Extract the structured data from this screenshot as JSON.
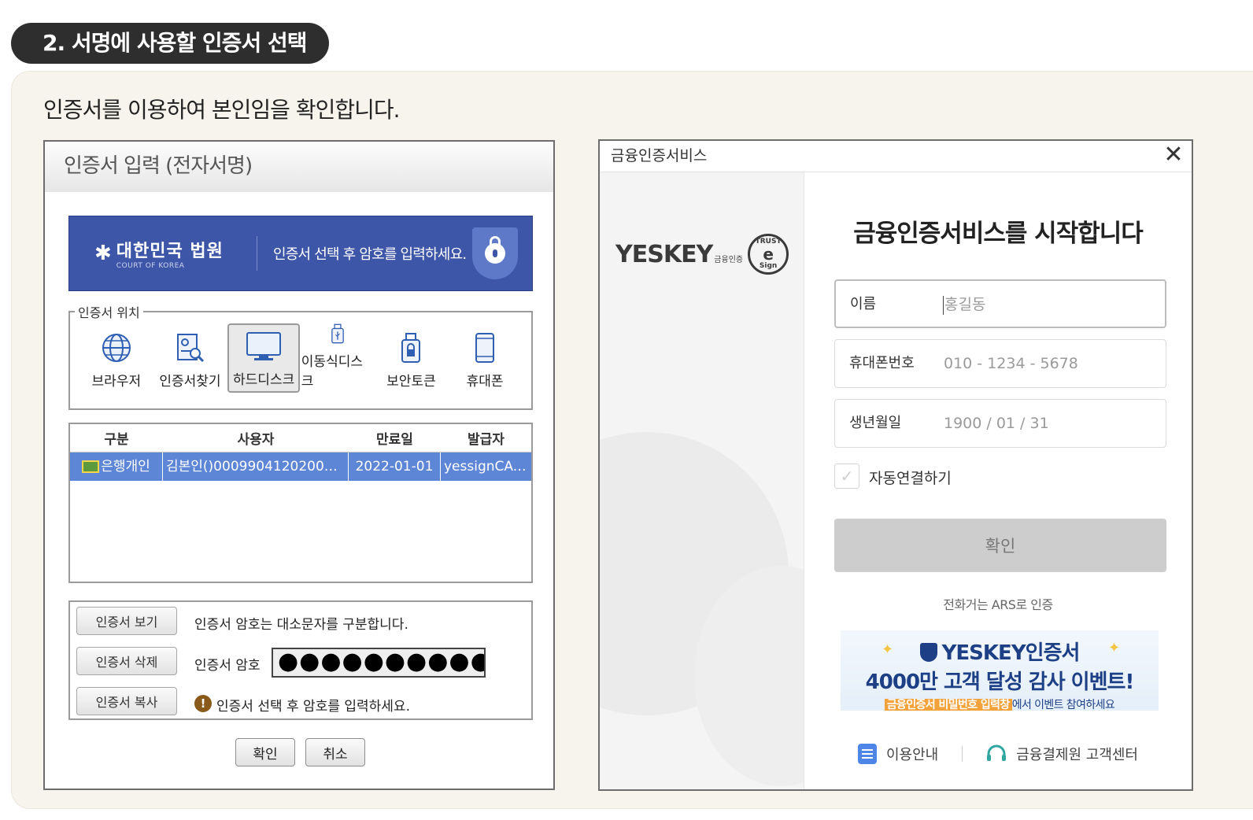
{
  "step": {
    "title": "2. 서명에 사용할 인증서 선택"
  },
  "intro": "인증서를 이용하여 본인임을 확인합니다.",
  "court_dialog": {
    "title": "인증서 입력 (전자서명)",
    "banner": {
      "org_name_ko": "대한민국 법원",
      "org_name_en": "COURT OF KOREA",
      "message": "인증서 선택 후 암호를 입력하세요."
    },
    "location_legend": "인증서 위치",
    "locations": [
      {
        "label": "브라우저",
        "icon": "globe-icon"
      },
      {
        "label": "인증서찾기",
        "icon": "cert-search-icon"
      },
      {
        "label": "하드디스크",
        "icon": "monitor-icon",
        "selected": true
      },
      {
        "label": "이동식디스크",
        "icon": "usb-icon"
      },
      {
        "label": "보안토큰",
        "icon": "security-token-icon"
      },
      {
        "label": "휴대폰",
        "icon": "phone-icon"
      }
    ],
    "table": {
      "headers": [
        "구분",
        "사용자",
        "만료일",
        "발급자"
      ],
      "rows": [
        {
          "type": "은행개인",
          "user": "김본인()0009904120200708...",
          "expiry": "2022-01-01",
          "issuer": "yessignCA-..."
        }
      ]
    },
    "buttons": {
      "view": "인증서 보기",
      "delete": "인증서 삭제",
      "copy": "인증서 복사",
      "ok": "확인",
      "cancel": "취소"
    },
    "case_notice": "인증서 암호는 대소문자를 구분합니다.",
    "password_label": "인증서 암호",
    "password_value": "●●●●●●●●●●",
    "warning": "인증서 선택 후 암호를 입력하세요."
  },
  "fin_dialog": {
    "window_title": "금융인증서비스",
    "close_label": "✕",
    "logo_word": "YESKEY",
    "logo_sub": "금융인증",
    "logo_mark_top": "TRUST",
    "logo_mark_bottom": "Sign",
    "heading": "금융인증서비스를 시작합니다",
    "fields": {
      "name": {
        "label": "이름",
        "placeholder": "홍길동"
      },
      "phone": {
        "label": "휴대폰번호",
        "placeholder": "010 - 1234 - 5678"
      },
      "birth": {
        "label": "생년월일",
        "placeholder": "1900 / 01 / 31"
      }
    },
    "auto_connect": "자동연결하기",
    "confirm": "확인",
    "ars": "전화거는 ARS로 인증",
    "event": {
      "line1": "YESKEY인증서",
      "line2": "4000만 고객 달성 감사 이벤트!",
      "line3_highlight": "금융인증서 비밀번호 입력창",
      "line3_rest": "에서 이벤트 참여하세요"
    },
    "footer": {
      "guide": "이용안내",
      "support": "금융결제원 고객센터"
    }
  }
}
